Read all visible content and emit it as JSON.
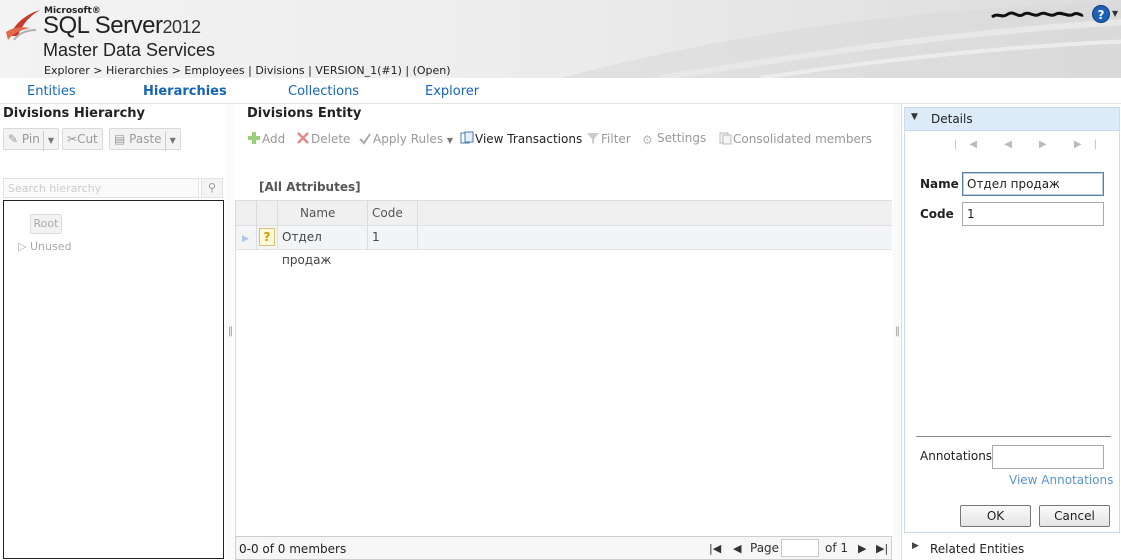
{
  "header": {
    "microsoft": "Microsoft®",
    "product": "SQL Server",
    "year": "2012",
    "subtitle": "Master Data Services",
    "breadcrumb": "Explorer > Hierarchies > Employees | Divisions | VERSION_1(#1) | (Open)",
    "help_icon": "?"
  },
  "nav": {
    "entities": "Entities",
    "hierarchies": "Hierarchies",
    "collections": "Collections",
    "explorer": "Explorer"
  },
  "left": {
    "title": "Divisions Hierarchy",
    "pin": "Pin",
    "cut": "Cut",
    "paste": "Paste",
    "search_placeholder": "Search hierarchy",
    "root": "Root",
    "unused": "Unused"
  },
  "mid": {
    "title": "Divisions Entity",
    "toolbar": {
      "add": "Add",
      "delete": "Delete",
      "apply_rules": "Apply Rules",
      "view_transactions": "View Transactions",
      "filter": "Filter",
      "settings": "Settings",
      "consolidated": "Consolidated members"
    },
    "attributes_label": "[All Attributes]",
    "columns": {
      "name": "Name",
      "code": "Code"
    },
    "rows": [
      {
        "status": "?",
        "name": "Отдел продаж",
        "code": "1"
      }
    ],
    "pager": {
      "count": "0-0 of 0 members",
      "page_label": "Page",
      "of_label": "of 1"
    }
  },
  "right": {
    "details": "Details",
    "name_label": "Name",
    "name_value": "Отдел продаж",
    "code_label": "Code",
    "code_value": "1",
    "annotations_label": "Annotations",
    "view_annotations": "View Annotations",
    "ok": "OK",
    "cancel": "Cancel",
    "related": "Related Entities"
  },
  "colors": {
    "link": "#1565b5",
    "details_header": "#dcebf7",
    "muted_link": "#5b95cf"
  }
}
